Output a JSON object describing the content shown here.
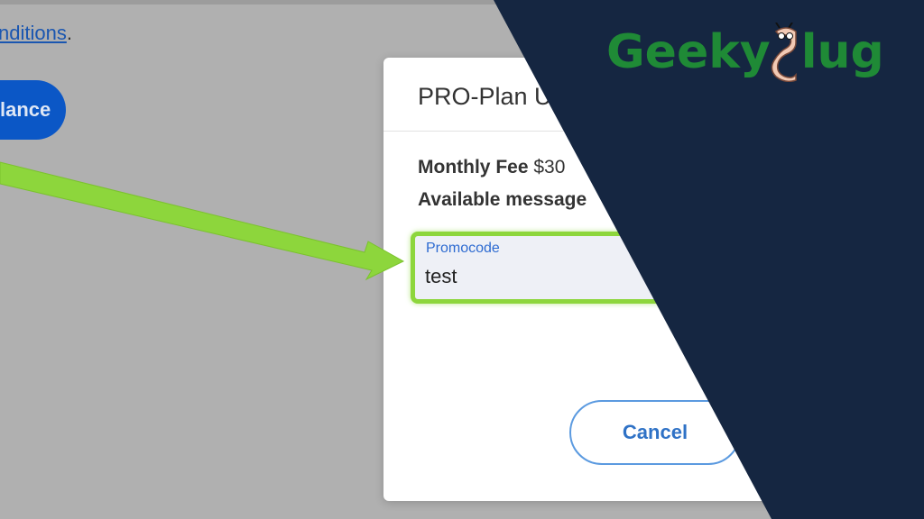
{
  "background": {
    "link_line_suffix": ".",
    "link_text": "nditions",
    "button_label": "lance"
  },
  "dialog": {
    "title": "PRO-Plan U",
    "monthly_fee_label": "Monthly Fee",
    "monthly_fee_value": " $30",
    "available_messages_label": "Available message",
    "promo": {
      "label": "Promocode",
      "value": "test"
    },
    "cancel_label": "Cancel"
  },
  "brand": {
    "logo_left": "Geeky",
    "logo_right": "lug",
    "overlay_color": "#152641",
    "logo_color": "#1f8a36",
    "highlight_color": "#8dd63c"
  }
}
